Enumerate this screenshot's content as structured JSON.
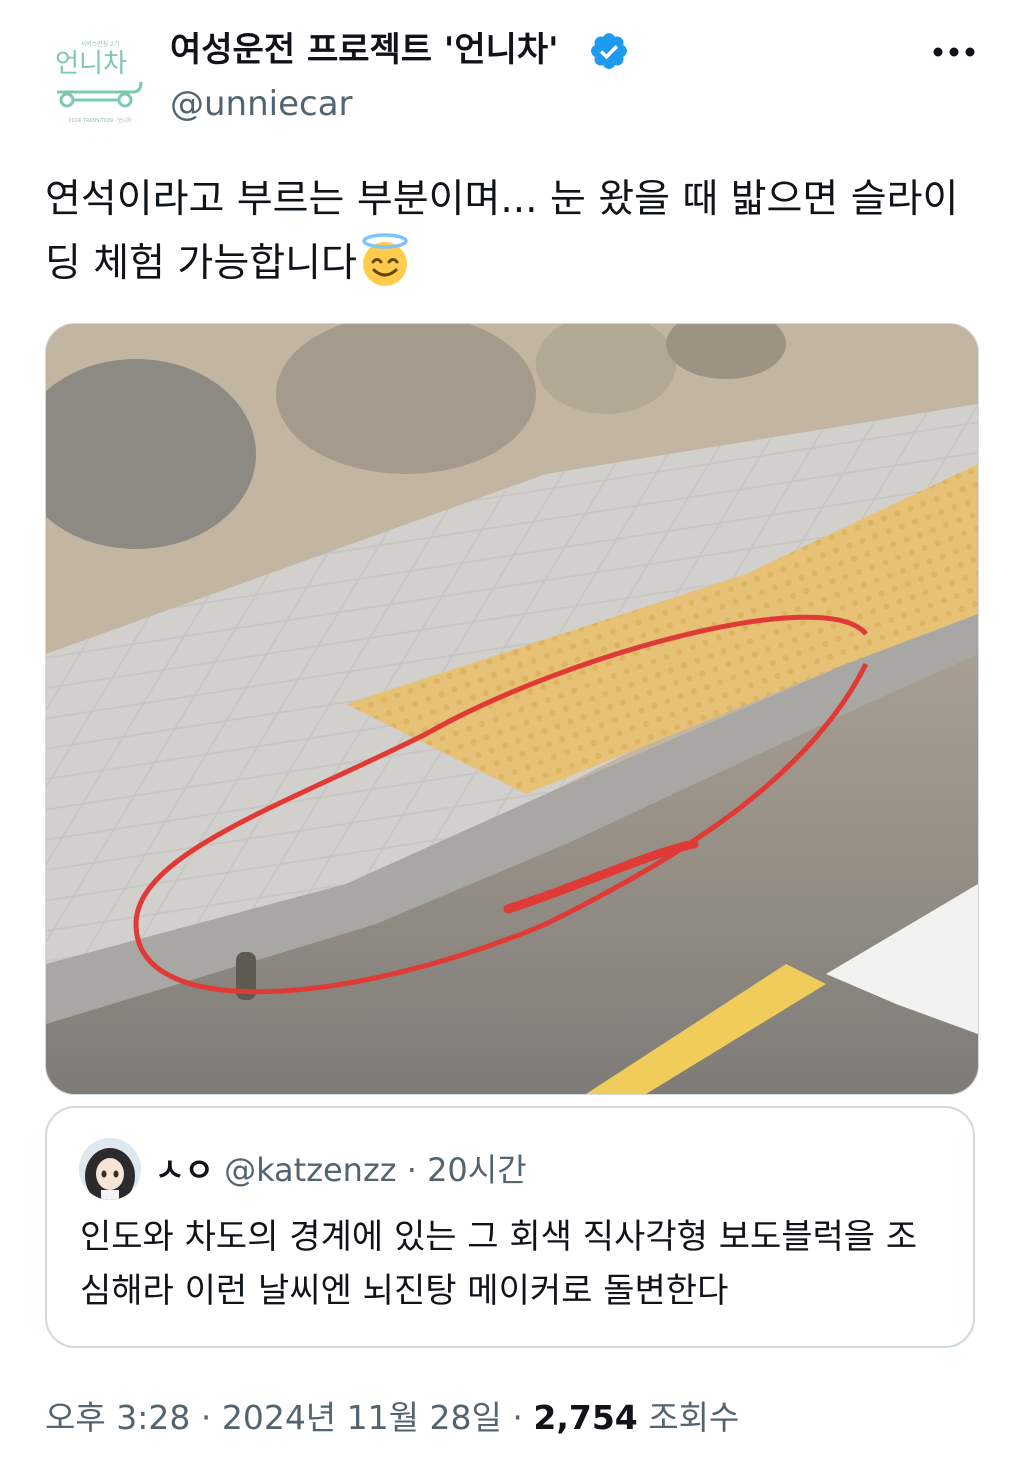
{
  "author": {
    "display_name": "여성운전 프로젝트 '언니차'",
    "handle": "@unniecar",
    "verified": true,
    "avatar_logo_text": "언니차",
    "avatar_caption_top": "서비스런칭 2기",
    "avatar_caption_bottom": "2024 TRANSITION · 언니차"
  },
  "more_icon": "more-horizontal-icon",
  "tweet": {
    "text": "연석이라고 부르는 부분이며... 눈 왔을 때 밟으면 슬라이딩 체험 가능합니다",
    "emoji": "smiling-face-with-halo-icon"
  },
  "media": {
    "alt": "photo of sidewalk curb with red circle"
  },
  "quote": {
    "name": "ㅅㅇ",
    "handle": "@katzenzz",
    "separator": "·",
    "time": "20시간",
    "text": "인도와 차도의 경계에 있는 그 회색 직사각형 보도블럭을 조심해라 이런 날씨엔 뇌진탕 메이커로 돌변한다"
  },
  "footer": {
    "time": "오후 3:28",
    "sep1": "·",
    "date": "2024년 11월 28일",
    "sep2": "·",
    "views": "2,754",
    "views_label": "조회수"
  },
  "colors": {
    "verified": "#1d9bf0",
    "text": "#0f1419",
    "secondary": "#536471",
    "border": "#cfd9de",
    "logo_green": "#7cc8b4"
  }
}
